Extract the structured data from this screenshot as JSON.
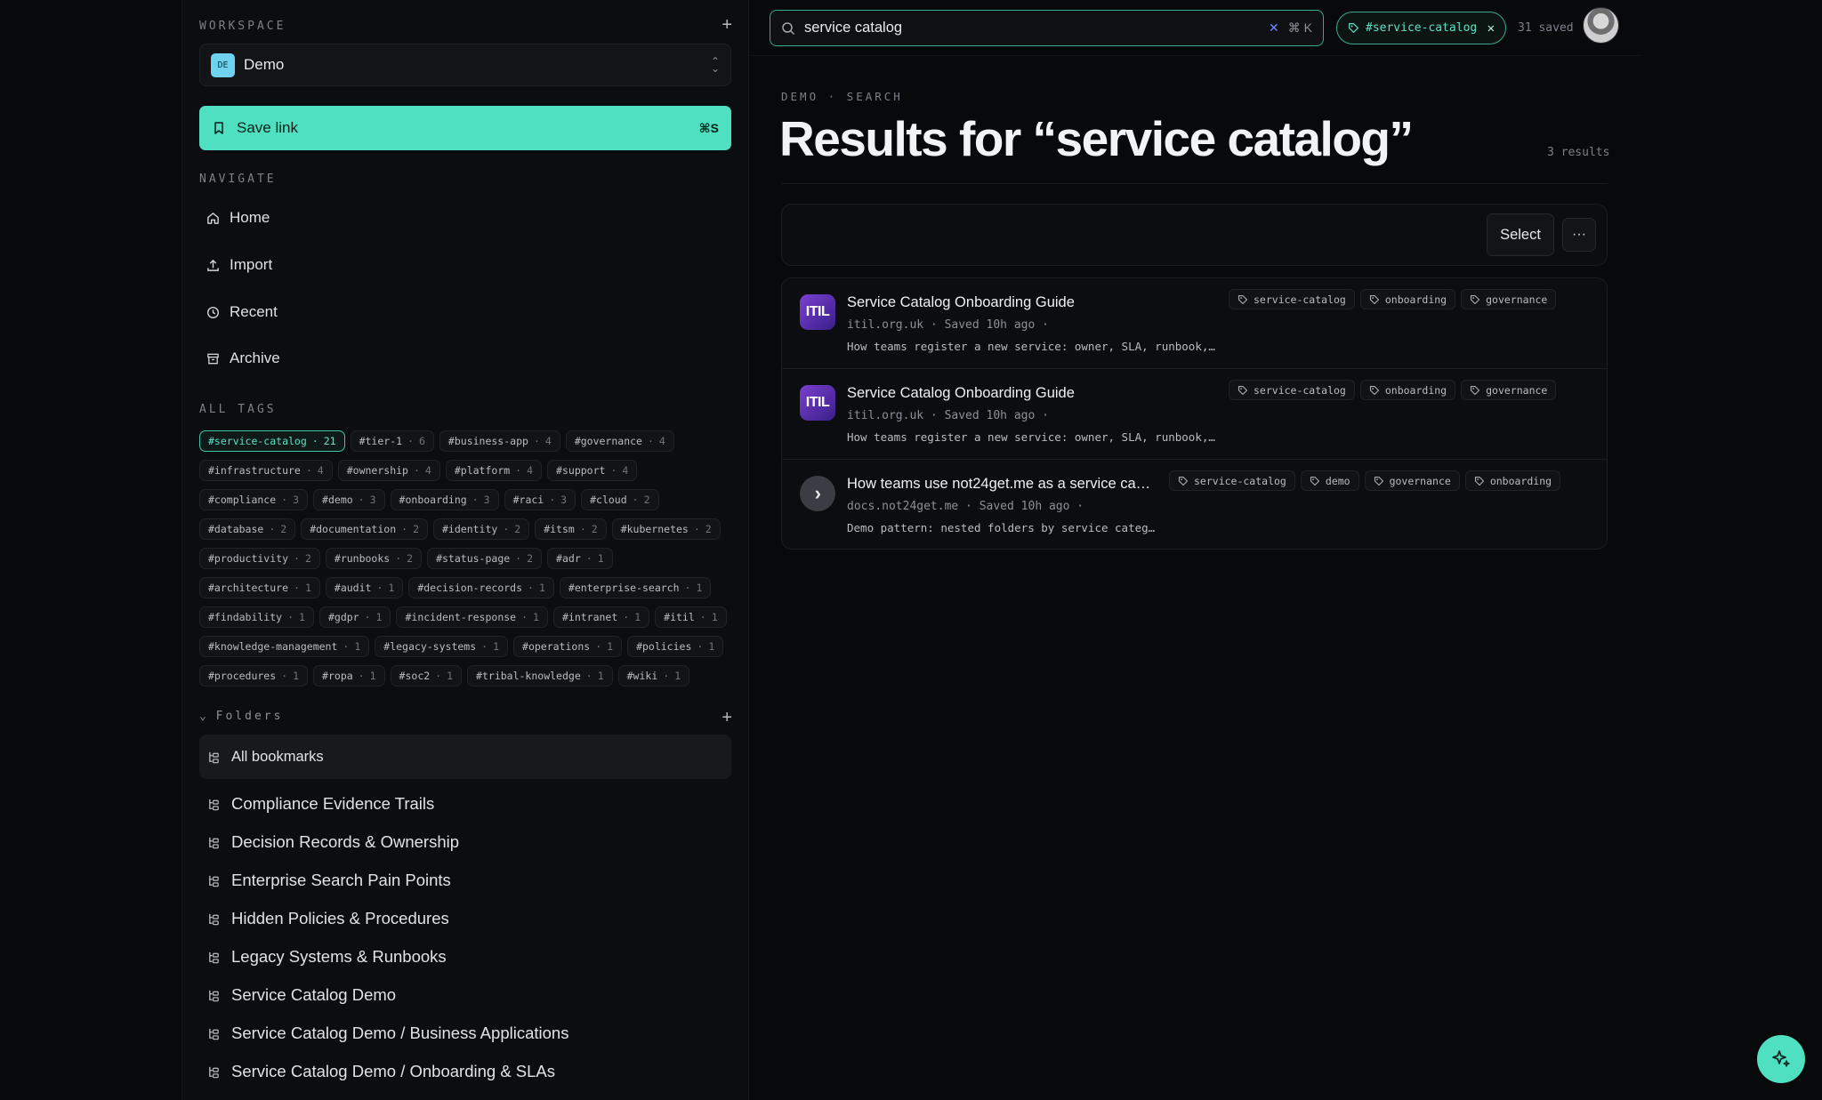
{
  "sidebar": {
    "workspace_label": "WORKSPACE",
    "workspace": {
      "badge": "DE",
      "name": "Demo"
    },
    "save_button": {
      "label": "Save link",
      "shortcut": "⌘S"
    },
    "navigate_label": "NAVIGATE",
    "nav": [
      {
        "label": "Home",
        "icon": "home-icon"
      },
      {
        "label": "Import",
        "icon": "import-icon"
      },
      {
        "label": "Recent",
        "icon": "clock-icon"
      },
      {
        "label": "Archive",
        "icon": "archive-icon"
      }
    ],
    "tags_label": "ALL TAGS",
    "tags": [
      {
        "name": "#service-catalog",
        "count": "21",
        "active": true
      },
      {
        "name": "#tier-1",
        "count": "6"
      },
      {
        "name": "#business-app",
        "count": "4"
      },
      {
        "name": "#governance",
        "count": "4"
      },
      {
        "name": "#infrastructure",
        "count": "4"
      },
      {
        "name": "#ownership",
        "count": "4"
      },
      {
        "name": "#platform",
        "count": "4"
      },
      {
        "name": "#support",
        "count": "4"
      },
      {
        "name": "#compliance",
        "count": "3"
      },
      {
        "name": "#demo",
        "count": "3"
      },
      {
        "name": "#onboarding",
        "count": "3"
      },
      {
        "name": "#raci",
        "count": "3"
      },
      {
        "name": "#cloud",
        "count": "2"
      },
      {
        "name": "#database",
        "count": "2"
      },
      {
        "name": "#documentation",
        "count": "2"
      },
      {
        "name": "#identity",
        "count": "2"
      },
      {
        "name": "#itsm",
        "count": "2"
      },
      {
        "name": "#kubernetes",
        "count": "2"
      },
      {
        "name": "#productivity",
        "count": "2"
      },
      {
        "name": "#runbooks",
        "count": "2"
      },
      {
        "name": "#status-page",
        "count": "2"
      },
      {
        "name": "#adr",
        "count": "1"
      },
      {
        "name": "#architecture",
        "count": "1"
      },
      {
        "name": "#audit",
        "count": "1"
      },
      {
        "name": "#decision-records",
        "count": "1"
      },
      {
        "name": "#enterprise-search",
        "count": "1"
      },
      {
        "name": "#findability",
        "count": "1"
      },
      {
        "name": "#gdpr",
        "count": "1"
      },
      {
        "name": "#incident-response",
        "count": "1"
      },
      {
        "name": "#intranet",
        "count": "1"
      },
      {
        "name": "#itil",
        "count": "1"
      },
      {
        "name": "#knowledge-management",
        "count": "1"
      },
      {
        "name": "#legacy-systems",
        "count": "1"
      },
      {
        "name": "#operations",
        "count": "1"
      },
      {
        "name": "#policies",
        "count": "1"
      },
      {
        "name": "#procedures",
        "count": "1"
      },
      {
        "name": "#ropa",
        "count": "1"
      },
      {
        "name": "#soc2",
        "count": "1"
      },
      {
        "name": "#tribal-knowledge",
        "count": "1"
      },
      {
        "name": "#wiki",
        "count": "1"
      }
    ],
    "folders_label": "Folders",
    "folders": [
      "All bookmarks",
      "Compliance Evidence Trails",
      "Decision Records & Ownership",
      "Enterprise Search Pain Points",
      "Hidden Policies & Procedures",
      "Legacy Systems & Runbooks",
      "Service Catalog Demo",
      "Service Catalog Demo / Business Applications",
      "Service Catalog Demo / Onboarding & SLAs"
    ]
  },
  "topbar": {
    "search_value": "service catalog",
    "search_shortcut": "⌘ K",
    "filter_chip": "#service-catalog",
    "saved_count": "31 saved"
  },
  "main": {
    "breadcrumb": "DEMO · SEARCH",
    "title": "Results for “service catalog”",
    "result_count": "3 results",
    "select_label": "Select",
    "more_label": "···",
    "results": [
      {
        "favicon": "ITIL",
        "title": "Service Catalog Onboarding Guide",
        "meta": "itil.org.uk · Saved 10h ago ·",
        "desc": "How teams register a new service: owner, SLA, runbook,…",
        "tags": [
          "service-catalog",
          "onboarding",
          "governance"
        ]
      },
      {
        "favicon": "ITIL",
        "title": "Service Catalog Onboarding Guide",
        "meta": "itil.org.uk · Saved 10h ago ·",
        "desc": "How teams register a new service: owner, SLA, runbook,…",
        "tags": [
          "service-catalog",
          "onboarding",
          "governance"
        ]
      },
      {
        "favicon": "›",
        "title": "How teams use not24get.me as a service ca…",
        "meta": "docs.not24get.me · Saved 10h ago ·",
        "desc": "Demo pattern: nested folders by service categ…",
        "tags": [
          "service-catalog",
          "demo",
          "governance",
          "onboarding"
        ]
      }
    ]
  },
  "colors": {
    "accent": "#4ee0c0",
    "background": "#08090b",
    "sidebar": "#0c0d10"
  }
}
